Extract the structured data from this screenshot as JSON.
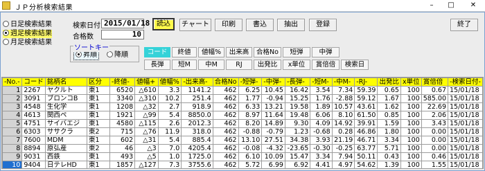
{
  "window": {
    "title": "ＪＰ分析検索結果",
    "min_label": "–",
    "max_label": "□",
    "close_label": "✕"
  },
  "result_type": {
    "items": [
      {
        "label": "日足検索結果",
        "selected": false
      },
      {
        "label": "週足検索結果",
        "selected": true
      },
      {
        "label": "月足検索結果",
        "selected": false
      }
    ]
  },
  "search_date": {
    "label": "検索日付",
    "value": "2015/01/18"
  },
  "match_count": {
    "label": "合格数",
    "value": "10"
  },
  "toolbar": {
    "load": "読込",
    "chart": "チャート",
    "print": "印刷",
    "write": "書込",
    "extract": "抽出",
    "register": "登録",
    "exit": "終了"
  },
  "sort_key": {
    "label": "ソートキー",
    "ascending": "昇順",
    "descending": "降順",
    "ascending_selected": true
  },
  "sort_buttons": [
    {
      "label": "コード",
      "active": true
    },
    {
      "label": "終値",
      "active": false
    },
    {
      "label": "値幅%",
      "active": false
    },
    {
      "label": "出来高",
      "active": false
    },
    {
      "label": "合格No",
      "active": false
    },
    {
      "label": "短弾",
      "active": false
    },
    {
      "label": "中弾",
      "active": false
    },
    {
      "label": "長弾",
      "active": false
    },
    {
      "label": "短M",
      "active": false
    },
    {
      "label": "中M",
      "active": false
    },
    {
      "label": "RJ",
      "active": false
    },
    {
      "label": "出発比",
      "active": false
    },
    {
      "label": "x単位",
      "active": false
    },
    {
      "label": "賞倍倍",
      "active": false
    },
    {
      "label": "検索日",
      "active": false
    }
  ],
  "table": {
    "headers": [
      "-No.-",
      "コード",
      "銘柄名",
      "区分",
      "-終値-",
      "値幅+",
      "値幅%",
      "-出来高-",
      "合格No",
      "-短弾-",
      "-中弾-",
      "-長弾-",
      "-短M-",
      "-中M-",
      "-RJ-",
      "出発比",
      "x単位",
      "賞倍倍",
      "-検索日付-"
    ],
    "rows": [
      [
        "1",
        "2267",
        "ヤクルト",
        "東1",
        "6520",
        "△610",
        "3.3",
        "1141.2",
        "462",
        "6.25",
        "10.45",
        "16.42",
        "3.54",
        "7.34",
        "59.39",
        "0.65",
        "100",
        "0.67",
        "15/01/18"
      ],
      [
        "2",
        "3091",
        "ブロンコB",
        "東1",
        "3340",
        "△310",
        "10.2",
        "251.4",
        "462",
        "1.77",
        "-0.94",
        "15.25",
        "1.76",
        "-2.88",
        "59.12",
        "1.67",
        "100",
        "585.00",
        "15/01/18"
      ],
      [
        "3",
        "4548",
        "生化学",
        "東1",
        "1208",
        "△32",
        "2.7",
        "918.9",
        "462",
        "6.33",
        "13.21",
        "19.58",
        "1.89",
        "10.57",
        "43.61",
        "1.62",
        "100",
        "22.69",
        "15/01/18"
      ],
      [
        "4",
        "4613",
        "関西ペ",
        "東1",
        "1921",
        "△99",
        "5.4",
        "8850.0",
        "462",
        "8.97",
        "11.64",
        "19.48",
        "6.06",
        "8.10",
        "61.50",
        "0.85",
        "100",
        "2.06",
        "15/01/18"
      ],
      [
        "5",
        "4751",
        "サイバエジ",
        "東1",
        "4580",
        "△115",
        "2.6",
        "2012.3",
        "462",
        "8.20",
        "14.89",
        "9.30",
        "4.09",
        "14.92",
        "39.91",
        "1.59",
        "100",
        "3.43",
        "15/01/18"
      ],
      [
        "6",
        "6303",
        "ササクラ",
        "東2",
        "715",
        "△76",
        "11.9",
        "318.0",
        "462",
        "-0.88",
        "-0.79",
        "1.23",
        "-0.68",
        "0.28",
        "46.86",
        "1.80",
        "100",
        "0.00",
        "15/01/18"
      ],
      [
        "7",
        "7600",
        "MDM",
        "東1",
        "602",
        "△31",
        "5.4",
        "885.4",
        "462",
        "13.10",
        "27.51",
        "34.38",
        "3.93",
        "21.19",
        "46.71",
        "3.34",
        "100",
        "0.00",
        "15/01/18"
      ],
      [
        "8",
        "8894",
        "原弘産",
        "東2",
        "46",
        "△3",
        "7.0",
        "4205.4",
        "462",
        "-0.08",
        "-4.32",
        "-23.65",
        "-0.30",
        "-0.25",
        "63.77",
        "5.71",
        "100",
        "0.00",
        "15/01/18"
      ],
      [
        "9",
        "9031",
        "西鉄",
        "東1",
        "493",
        "△5",
        "1.0",
        "1725.0",
        "462",
        "6.10",
        "10.09",
        "15.47",
        "3.34",
        "7.94",
        "50.11",
        "0.43",
        "100",
        "0.46",
        "15/01/18"
      ],
      [
        "10",
        "9404",
        "日テレHD",
        "東1",
        "1857",
        "△127",
        "7.3",
        "3755.6",
        "462",
        "5.72",
        "6.99",
        "6.92",
        "4.41",
        "4.97",
        "54.62",
        "1.39",
        "100",
        "1.55",
        "15/01/18"
      ]
    ],
    "selected_row": 10
  }
}
